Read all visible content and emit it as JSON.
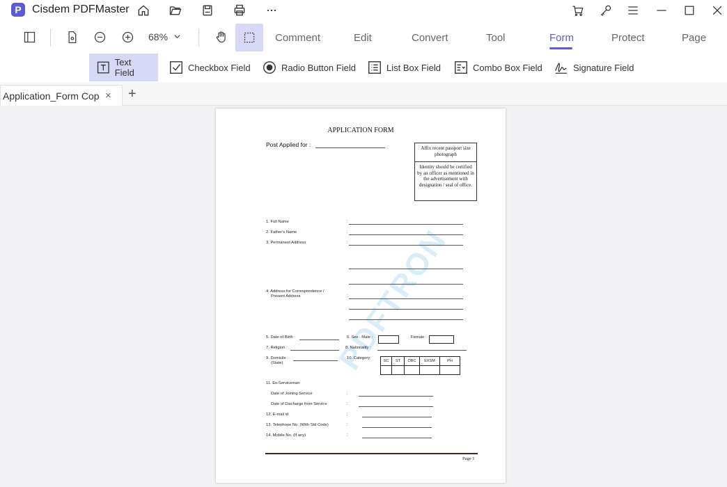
{
  "app": {
    "title": "Cisdem PDFMaster",
    "logo_letter": "P"
  },
  "toolbar": {
    "zoom": "68%",
    "tabs": [
      "Comment",
      "Edit",
      "Convert",
      "Tool",
      "Form",
      "Protect",
      "Page"
    ],
    "active_tab": "Form"
  },
  "formbar": {
    "items": [
      "Text Field",
      "Checkbox Field",
      "Radio Button Field",
      "List Box Field",
      "Combo Box Field",
      "Signature Field"
    ],
    "active_item": "Text Field"
  },
  "doc_tabs": {
    "items": [
      "Application_Form Cop..."
    ],
    "close": "×",
    "add": "+"
  },
  "document": {
    "title": "APPLICATION FORM",
    "post_label": "Post Applied for  :",
    "photo_box": {
      "top": "Affix recent passport size photograph",
      "bottom": "Identity should be certified by an officer as mentioned in the advertisement with designation / seal of office."
    },
    "fields": {
      "full_name": "1. Full Name",
      "father": "2. Father's Name",
      "permanent": "3. Permanent Address",
      "corr1": "4. Address for Correspondence /",
      "corr2": "Present Address",
      "dob": "5. Date of Birth :",
      "sex": "6.  Sex : Male :",
      "female": "Female :",
      "religion": "7. Religion :",
      "nationality": "8.  Nationality :",
      "domicile1": "9. Domicile :",
      "domicile2": "(State)",
      "category": "10.   Category:",
      "ex": "11. Ex-Serviceman",
      "joining": "Date of Joining Service",
      "discharge": "Date of Discharge from Service",
      "email": "12. E-mail id",
      "telephone": "13. Telephone No. (With Std Code)",
      "mobile": "14. Mobile No.   (If any)"
    },
    "categories": [
      "SC",
      "ST",
      "OBC",
      "EXSM",
      "PH"
    ],
    "page_label": "Page 1",
    "watermark": "PDFTRON"
  }
}
